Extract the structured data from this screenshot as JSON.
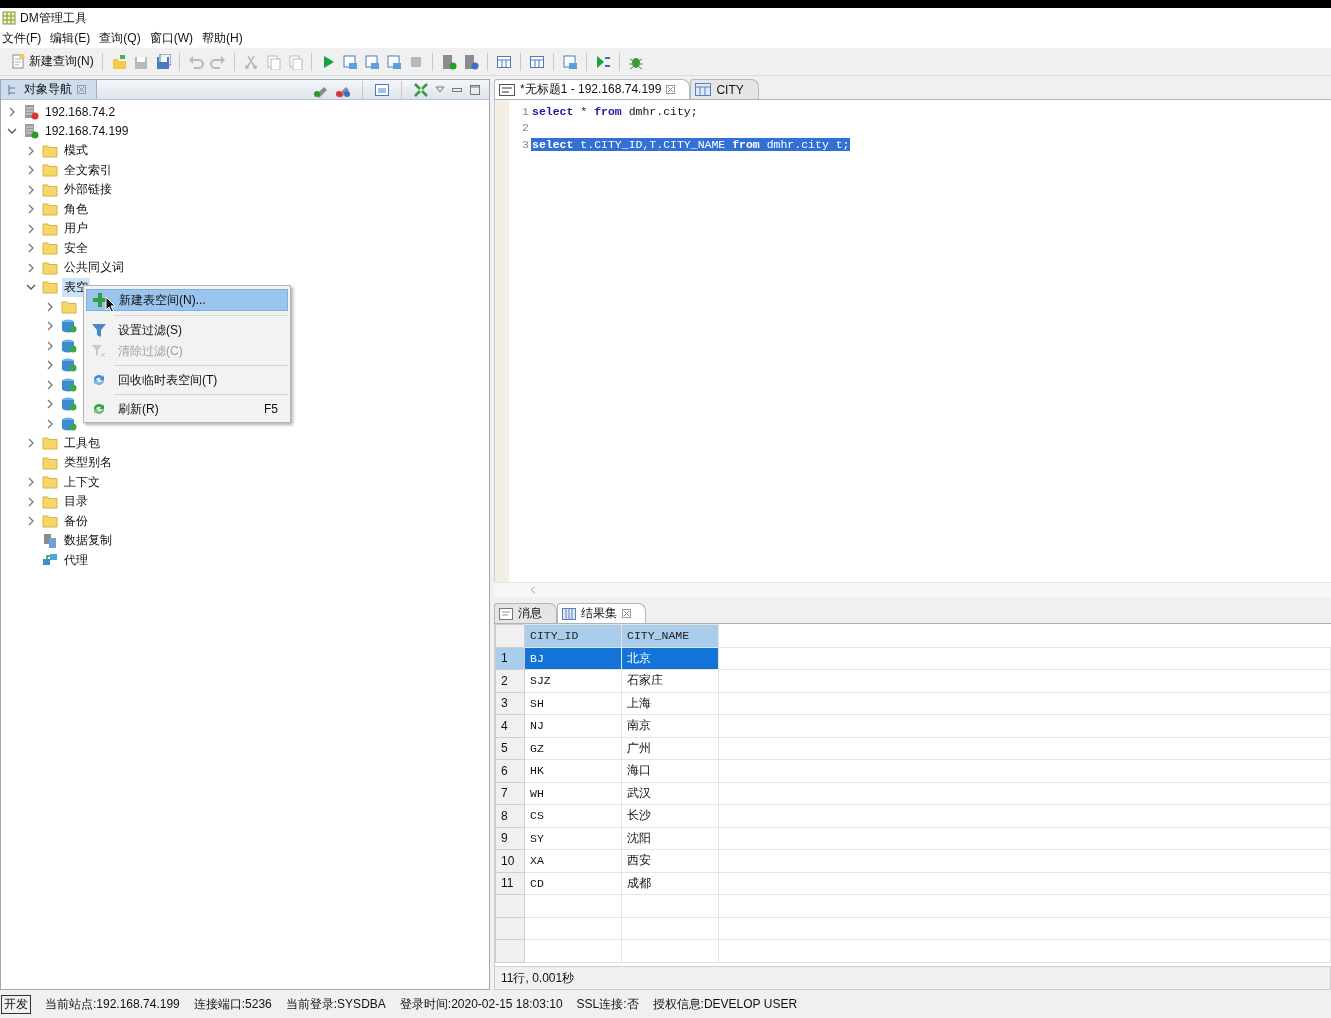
{
  "window": {
    "title": "DM管理工具"
  },
  "menu_bar": [
    {
      "label": "文件(F)"
    },
    {
      "label": "编辑(E)"
    },
    {
      "label": "查询(Q)"
    },
    {
      "label": "窗口(W)"
    },
    {
      "label": "帮助(H)"
    }
  ],
  "toolbar": {
    "new_query": "新建查询(N)",
    "groups": [
      [
        {
          "kind": "open",
          "disabled": false
        },
        {
          "kind": "save",
          "disabled": true
        },
        {
          "kind": "save-all",
          "disabled": false
        }
      ],
      [
        {
          "kind": "undo",
          "disabled": true
        },
        {
          "kind": "redo",
          "disabled": true
        }
      ],
      [
        {
          "kind": "cut",
          "disabled": true
        },
        {
          "kind": "copy",
          "disabled": true
        },
        {
          "kind": "paste",
          "disabled": true
        }
      ],
      [
        {
          "kind": "run",
          "disabled": false
        },
        {
          "kind": "step",
          "disabled": false
        },
        {
          "kind": "loop",
          "disabled": false
        },
        {
          "kind": "run-script",
          "disabled": false
        },
        {
          "kind": "stop",
          "disabled": true
        }
      ],
      [
        {
          "kind": "db-check",
          "disabled": false
        },
        {
          "kind": "db-link",
          "disabled": false
        }
      ],
      [
        {
          "kind": "history",
          "disabled": false
        }
      ],
      [
        {
          "kind": "grid",
          "disabled": false
        }
      ],
      [
        {
          "kind": "explain",
          "disabled": false
        }
      ],
      [
        {
          "kind": "debug-step",
          "disabled": false
        }
      ],
      [
        {
          "kind": "bug",
          "disabled": false
        }
      ]
    ]
  },
  "object_navigator": {
    "title": "对象导航",
    "tree": [
      {
        "label": "192.168.74.2",
        "kind": "server-off",
        "expanded": false,
        "selected": false
      },
      {
        "label": "192.168.74.199",
        "kind": "server-on",
        "expanded": true,
        "selected": false,
        "children": [
          {
            "label": "模式",
            "kind": "folder",
            "expanded": false,
            "selected": false
          },
          {
            "label": "全文索引",
            "kind": "folder",
            "expanded": false,
            "selected": false
          },
          {
            "label": "外部链接",
            "kind": "folder",
            "expanded": false,
            "selected": false
          },
          {
            "label": "角色",
            "kind": "folder",
            "expanded": false,
            "selected": false
          },
          {
            "label": "用户",
            "kind": "folder",
            "expanded": false,
            "selected": false
          },
          {
            "label": "安全",
            "kind": "folder",
            "expanded": false,
            "selected": false
          },
          {
            "label": "公共同义词",
            "kind": "folder",
            "expanded": false,
            "selected": false
          },
          {
            "label": "表空",
            "kind": "folder",
            "expanded": true,
            "selected": true,
            "children": [
              {
                "kind": "folder",
                "expanded": false
              },
              {
                "kind": "tablespace",
                "expanded": false
              },
              {
                "kind": "tablespace",
                "expanded": false
              },
              {
                "kind": "tablespace",
                "expanded": false
              },
              {
                "kind": "tablespace",
                "expanded": false
              },
              {
                "kind": "tablespace",
                "expanded": false
              },
              {
                "kind": "tablespace",
                "expanded": false
              }
            ]
          },
          {
            "label": "工具包",
            "kind": "folder",
            "expanded": false,
            "selected": false
          },
          {
            "label": "类型别名",
            "kind": "folder",
            "selected": false
          },
          {
            "label": "上下文",
            "kind": "folder",
            "expanded": false,
            "selected": false
          },
          {
            "label": "目录",
            "kind": "folder",
            "expanded": false,
            "selected": false
          },
          {
            "label": "备份",
            "kind": "folder",
            "expanded": false,
            "selected": false
          },
          {
            "label": "数据复制",
            "kind": "replication",
            "selected": false
          },
          {
            "label": "代理",
            "kind": "agent",
            "selected": false
          }
        ]
      }
    ],
    "context_menu": [
      [
        {
          "label": "新建表空间(N)...",
          "kind": "plus",
          "disabled": false,
          "selected": true
        }
      ],
      [
        {
          "label": "设置过滤(S)",
          "kind": "filter",
          "disabled": false,
          "selected": false
        },
        {
          "label": "清除过滤(C)",
          "kind": "clear-filter",
          "disabled": true,
          "selected": false
        }
      ],
      [
        {
          "label": "回收临时表空间(T)",
          "kind": "recycle",
          "disabled": false,
          "selected": false
        }
      ],
      [
        {
          "label": "刷新(R)",
          "kind": "refresh",
          "disabled": false,
          "selected": false,
          "shortcut": "F5"
        }
      ]
    ]
  },
  "editor_tabs": [
    {
      "label": "*无标题1 - 192.168.74.199",
      "kind": "sql",
      "selected": true
    },
    {
      "label": "CITY",
      "kind": "table",
      "selected": false
    }
  ],
  "editor": {
    "lines": [
      {
        "number": "1",
        "selected": false,
        "tokens": [
          {
            "text": "select",
            "kind": "keyword"
          },
          {
            "text": " * ",
            "kind": "plain"
          },
          {
            "text": "from",
            "kind": "keyword"
          },
          {
            "text": " dmhr.city;",
            "kind": "plain"
          }
        ]
      },
      {
        "number": "2",
        "selected": false
      },
      {
        "number": "3",
        "selected": true,
        "tokens": [
          {
            "text": "select",
            "kind": "keyword"
          },
          {
            "text": " t.CITY_ID,T.CITY_NAME ",
            "kind": "plain"
          },
          {
            "text": "from",
            "kind": "keyword"
          },
          {
            "text": " dmhr.city t;",
            "kind": "plain"
          }
        ]
      }
    ]
  },
  "result_tabs": [
    {
      "label": "消息",
      "kind": "message",
      "selected": false
    },
    {
      "label": "结果集",
      "kind": "grid",
      "selected": true
    }
  ],
  "result_table": {
    "columns": [
      "CITY_ID",
      "CITY_NAME"
    ],
    "rows": [
      {
        "number": "1",
        "cells": [
          "BJ",
          "北京"
        ],
        "selected": true
      },
      {
        "number": "2",
        "cells": [
          "SJZ",
          "石家庄"
        ],
        "selected": false
      },
      {
        "number": "3",
        "cells": [
          "SH",
          "上海"
        ],
        "selected": false
      },
      {
        "number": "4",
        "cells": [
          "NJ",
          "南京"
        ],
        "selected": false
      },
      {
        "number": "5",
        "cells": [
          "GZ",
          "广州"
        ],
        "selected": false
      },
      {
        "number": "6",
        "cells": [
          "HK",
          "海口"
        ],
        "selected": false
      },
      {
        "number": "7",
        "cells": [
          "WH",
          "武汉"
        ],
        "selected": false
      },
      {
        "number": "8",
        "cells": [
          "CS",
          "长沙"
        ],
        "selected": false
      },
      {
        "number": "9",
        "cells": [
          "SY",
          "沈阳"
        ],
        "selected": false
      },
      {
        "number": "10",
        "cells": [
          "XA",
          "西安"
        ],
        "selected": false
      },
      {
        "number": "11",
        "cells": [
          "CD",
          "成都"
        ],
        "selected": false
      }
    ]
  },
  "result_status": "11行, 0.001秒",
  "status_bar": {
    "mode": "开发",
    "items": [
      "当前站点:192.168.74.199",
      "连接端口:5236",
      "当前登录:SYSDBA",
      "登录时间:2020-02-15 18:03:10",
      "SSL连接:否",
      "授权信息:DEVELOP USER"
    ]
  }
}
